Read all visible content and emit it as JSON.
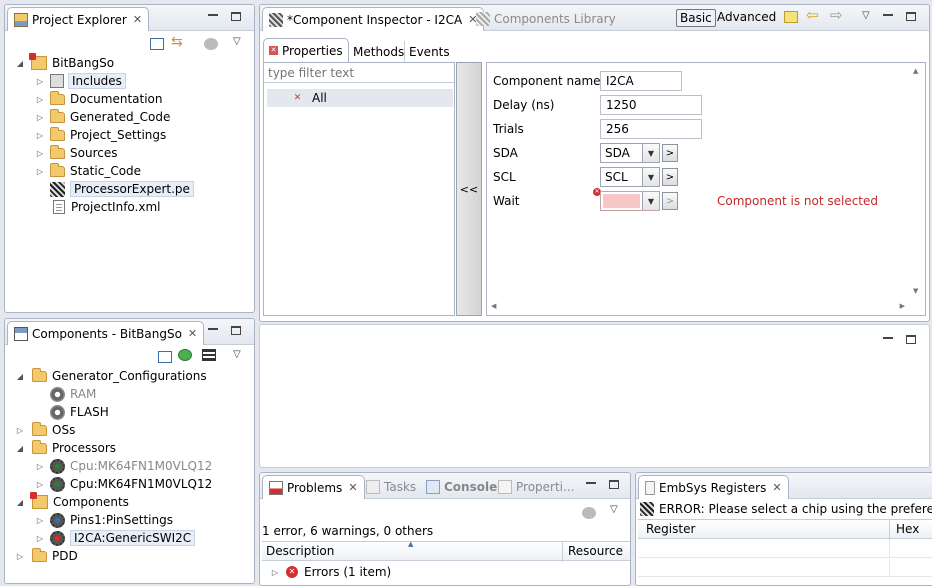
{
  "project_explorer": {
    "title": "Project Explorer",
    "tree": [
      {
        "label": "BitBangSo",
        "kind": "project",
        "expanded": true
      },
      {
        "label": "Includes",
        "kind": "includes"
      },
      {
        "label": "Documentation",
        "kind": "folder"
      },
      {
        "label": "Generated_Code",
        "kind": "folder"
      },
      {
        "label": "Project_Settings",
        "kind": "folder"
      },
      {
        "label": "Sources",
        "kind": "folder"
      },
      {
        "label": "Static_Code",
        "kind": "folder"
      },
      {
        "label": "ProcessorExpert.pe",
        "kind": "pe"
      },
      {
        "label": "ProjectInfo.xml",
        "kind": "file"
      }
    ]
  },
  "components_view": {
    "title": "Components - BitBangSo",
    "tree": [
      {
        "label": "Generator_Configurations"
      },
      {
        "label": "RAM"
      },
      {
        "label": "FLASH"
      },
      {
        "label": "OSs"
      },
      {
        "label": "Processors"
      },
      {
        "label": "Cpu:MK64FN1M0VLQ12"
      },
      {
        "label": "Cpu:MK64FN1M0VLQ12"
      },
      {
        "label": "Components"
      },
      {
        "label": "Pins1:PinSettings"
      },
      {
        "label": "I2CA:GenericSWI2C"
      },
      {
        "label": "PDD"
      }
    ]
  },
  "editor": {
    "tabs": [
      {
        "label": "*Component Inspector - I2CA",
        "active": true
      },
      {
        "label": "Components Library",
        "active": false
      }
    ],
    "mode_basic": "Basic",
    "mode_advanced": "Advanced",
    "subtabs": [
      "Properties",
      "Methods",
      "Events"
    ],
    "filter_placeholder": "type filter text",
    "filter_item": "All",
    "collapse_button": "<<",
    "properties": {
      "name_label": "Component name",
      "name_value": "I2CA",
      "delay_label": "Delay (ns)",
      "delay_value": "1250",
      "trials_label": "Trials",
      "trials_value": "256",
      "sda_label": "SDA",
      "sda_value": "SDA",
      "scl_label": "SCL",
      "scl_value": "SCL",
      "wait_label": "Wait",
      "wait_value": "",
      "error_message": "Component is not selected",
      "browse_glyph": ">"
    }
  },
  "problems": {
    "tabs": [
      "Problems",
      "Tasks",
      "Console",
      "Properti..."
    ],
    "summary": "1 error, 6 warnings, 0 others",
    "columns": [
      "Description",
      "Resource"
    ],
    "rows": [
      {
        "label": "Errors (1 item)"
      }
    ]
  },
  "embsys": {
    "title": "EmbSys Registers",
    "error": "ERROR: Please select a chip using the preference pag",
    "columns": [
      "Register",
      "Hex"
    ]
  },
  "colors": {
    "error_red": "#c62828",
    "accent": "#3b6ea5"
  }
}
